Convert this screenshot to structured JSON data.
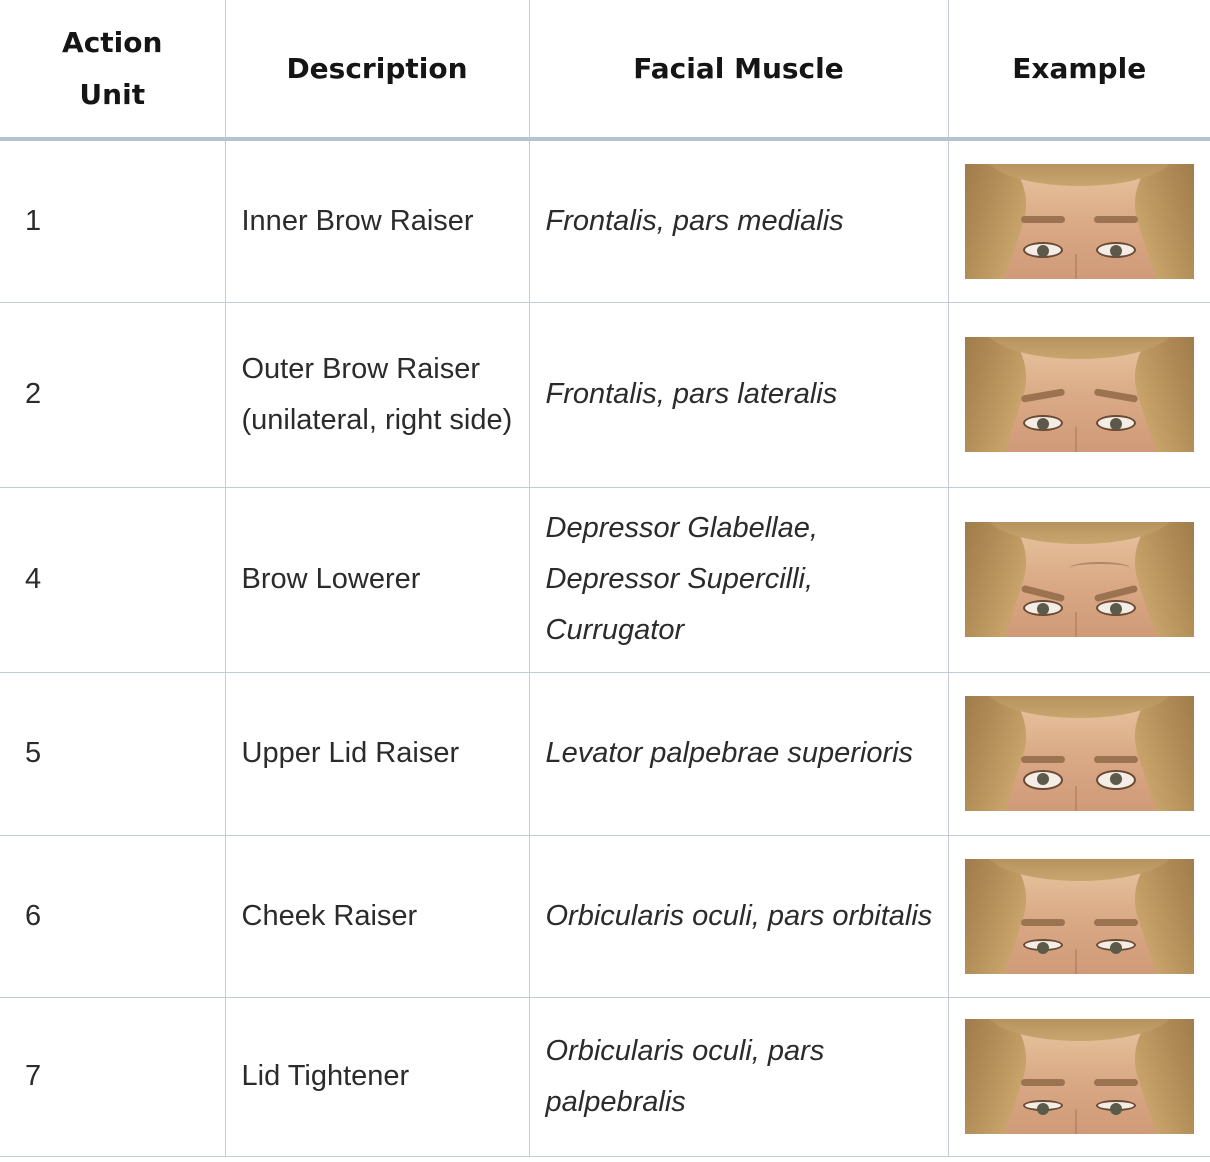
{
  "table": {
    "headers": {
      "unit_line1": "Action",
      "unit_line2": "Unit",
      "description": "Description",
      "muscle": "Facial Muscle",
      "example": "Example"
    },
    "rows": [
      {
        "unit": "1",
        "description": "Inner Brow Raiser",
        "muscle": "Frontalis, pars medialis",
        "example_icon": "face-photo-inner-brow-raiser"
      },
      {
        "unit": "2",
        "description": "Outer Brow Raiser (unilateral, right side)",
        "muscle": "Frontalis, pars lateralis",
        "example_icon": "face-photo-outer-brow-raiser"
      },
      {
        "unit": "4",
        "description": "Brow Lowerer",
        "muscle": "Depressor Glabellae, Depressor Supercilli, Currugator",
        "example_icon": "face-photo-brow-lowerer"
      },
      {
        "unit": "5",
        "description": "Upper Lid Raiser",
        "muscle": "Levator palpebrae superioris",
        "example_icon": "face-photo-upper-lid-raiser"
      },
      {
        "unit": "6",
        "description": "Cheek Raiser",
        "muscle": "Orbicularis oculi, pars orbitalis",
        "example_icon": "face-photo-cheek-raiser"
      },
      {
        "unit": "7",
        "description": "Lid Tightener",
        "muscle": "Orbicularis oculi, pars palpebralis",
        "example_icon": "face-photo-lid-tightener"
      }
    ]
  }
}
